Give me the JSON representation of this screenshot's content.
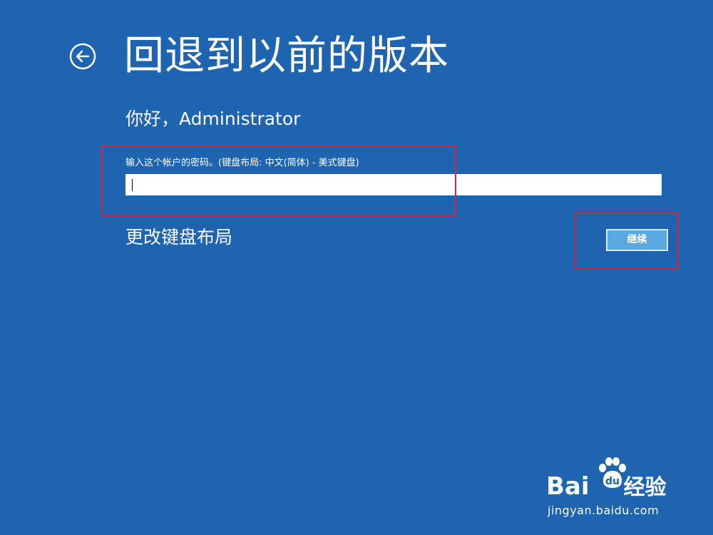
{
  "header": {
    "title": "回退到以前的版本",
    "back_icon": "arrow-left-circle-icon"
  },
  "account": {
    "greeting": "你好，Administrator"
  },
  "password": {
    "label": "输入这个帐户的密码。(键盘布局: 中文(简体) - 美式键盘)",
    "value": "",
    "placeholder": ""
  },
  "actions": {
    "change_keyboard_label": "更改键盘布局",
    "continue_label": "继续"
  },
  "watermark": {
    "brand": "Bai",
    "brand_tail": "u",
    "brand_cn": "经验",
    "url": "jingyan.baidu.com"
  },
  "colors": {
    "background": "#1e64b0",
    "text": "#ffffff",
    "continue_button": "#59a9e0",
    "highlight": "#d2283c"
  }
}
